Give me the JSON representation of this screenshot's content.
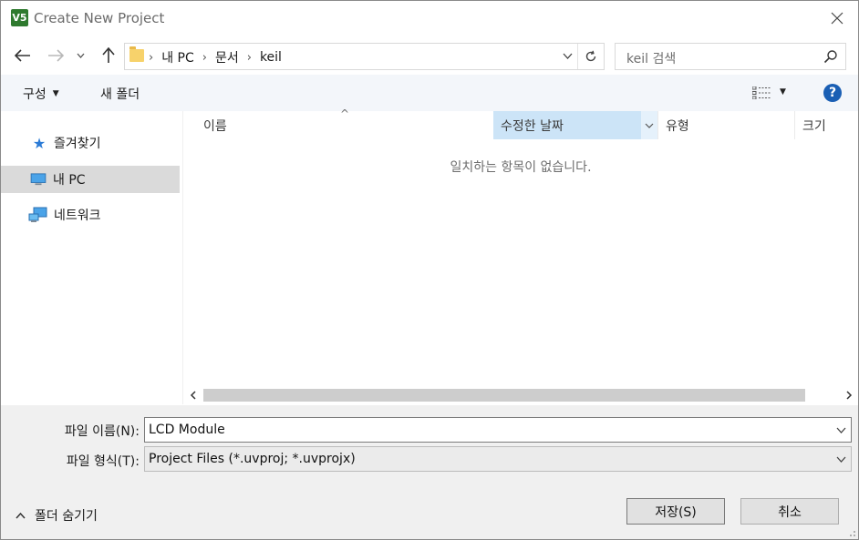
{
  "window": {
    "title": "Create New Project",
    "app_icon_text": "V5"
  },
  "nav": {
    "back_icon": "arrow-left",
    "forward_icon": "arrow-right",
    "up_icon": "arrow-up",
    "breadcrumbs": [
      "내 PC",
      "문서",
      "keil"
    ],
    "search_placeholder": "keil 검색"
  },
  "commandbar": {
    "organize_label": "구성",
    "new_folder_label": "새 폴더",
    "help_glyph": "?"
  },
  "sidebar": {
    "items": [
      {
        "label": "즐겨찾기",
        "icon": "star-icon"
      },
      {
        "label": "내 PC",
        "icon": "computer-icon",
        "selected": true
      },
      {
        "label": "네트워크",
        "icon": "network-icon"
      }
    ]
  },
  "filelist": {
    "columns": {
      "name": "이름",
      "date": "수정한 날짜",
      "type": "유형",
      "size": "크기"
    },
    "sorted_column": "date",
    "empty_message": "일치하는 항목이 없습니다."
  },
  "form": {
    "filename_label": "파일 이름(N):",
    "filename_value": "LCD Module",
    "filetype_label": "파일 형식(T):",
    "filetype_value": "Project Files (*.uvproj; *.uvprojx)",
    "hide_folders_label": "폴더 숨기기",
    "save_label": "저장(S)",
    "cancel_label": "취소"
  },
  "colors": {
    "accent": "#1a5fb4",
    "selected_column": "#cce4f7",
    "selected_sidebar": "#dadada"
  }
}
